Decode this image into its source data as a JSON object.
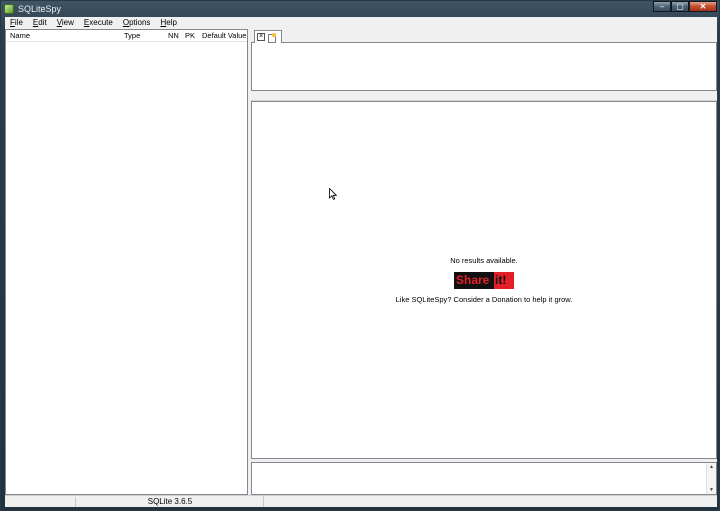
{
  "window": {
    "title": "SQLiteSpy",
    "minimize_glyph": "–",
    "maximize_glyph": "▢",
    "close_glyph": "✕"
  },
  "menu": {
    "items": [
      {
        "label": "File"
      },
      {
        "label": "Edit"
      },
      {
        "label": "View"
      },
      {
        "label": "Execute"
      },
      {
        "label": "Options"
      },
      {
        "label": "Help"
      }
    ]
  },
  "schema_tree": {
    "columns": [
      "Name",
      "Type",
      "NN",
      "PK",
      "Default Value"
    ]
  },
  "editor_tab": {
    "close_glyph": "×"
  },
  "results": {
    "message": "No results available.",
    "shareit_left": "Share",
    "shareit_right": "it!",
    "donation_text": "Like SQLiteSpy? Consider a Donation to help it grow."
  },
  "statusbar": {
    "version": "SQLite 3.6.5"
  },
  "icons": {
    "app": "sqlitespy-app-icon",
    "tab_close": "close-icon",
    "tab_doc": "document-icon",
    "cursor": "mouse-pointer-icon"
  },
  "colors": {
    "shareit_red": "#e3202a",
    "shareit_black": "#111111",
    "title_bar": "#2b3d4c",
    "close_button": "#c24c2e"
  }
}
